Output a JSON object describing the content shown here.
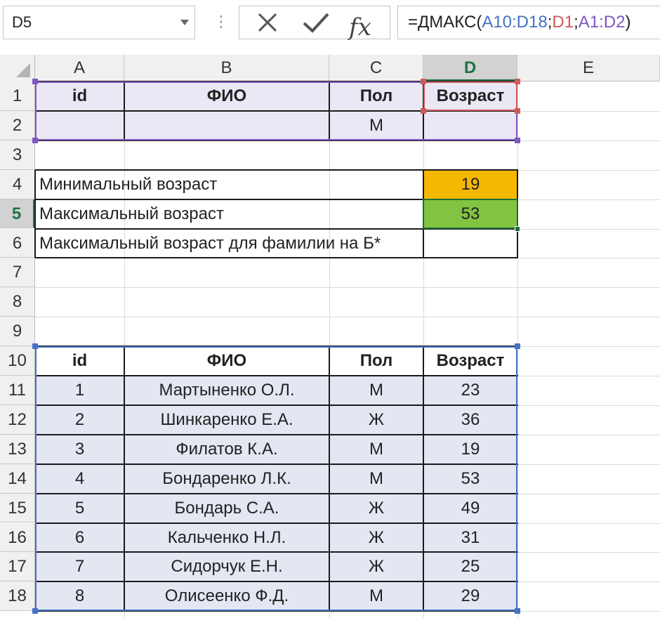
{
  "formula_bar": {
    "name_box": "D5",
    "formula_parts": [
      {
        "text": "=ДМАКС(",
        "ref": ""
      },
      {
        "text": "A10:D18",
        "ref": "a"
      },
      {
        "text": ";",
        "ref": ""
      },
      {
        "text": "D1",
        "ref": "d"
      },
      {
        "text": ";",
        "ref": ""
      },
      {
        "text": "A1:D2",
        "ref": "b"
      },
      {
        "text": ")",
        "ref": ""
      }
    ],
    "fx_label": "fx",
    "dots": "⋮"
  },
  "columns": [
    "A",
    "B",
    "C",
    "D",
    "E"
  ],
  "selected_column": "D",
  "selected_row": "5",
  "rows": [
    "1",
    "2",
    "3",
    "4",
    "5",
    "6",
    "7",
    "8",
    "9",
    "10",
    "11",
    "12",
    "13",
    "14",
    "15",
    "16",
    "17",
    "18"
  ],
  "criteria": {
    "headers": [
      "id",
      "ФИО",
      "Пол",
      "Возраст"
    ],
    "values": [
      "",
      "",
      "М",
      ""
    ]
  },
  "summary": [
    {
      "label": "Минимальный возраст",
      "value": "19"
    },
    {
      "label": "Максимальный возраст",
      "value": "53"
    },
    {
      "label": "Максимальный возраст для фамилии на Б*",
      "value": ""
    }
  ],
  "table": {
    "headers": [
      "id",
      "ФИО",
      "Пол",
      "Возраст"
    ],
    "rows": [
      [
        "1",
        "Мартыненко О.Л.",
        "М",
        "23"
      ],
      [
        "2",
        "Шинкаренко Е.А.",
        "Ж",
        "36"
      ],
      [
        "3",
        "Филатов К.А.",
        "М",
        "19"
      ],
      [
        "4",
        "Бондаренко Л.К.",
        "М",
        "53"
      ],
      [
        "5",
        "Бондарь С.А.",
        "Ж",
        "49"
      ],
      [
        "6",
        "Кальченко Н.Л.",
        "Ж",
        "31"
      ],
      [
        "7",
        "Сидорчук Е.Н.",
        "Ж",
        "25"
      ],
      [
        "8",
        "Олисеенко Ф.Д.",
        "М",
        "29"
      ]
    ]
  },
  "colors": {
    "min_fill": "#f5b800",
    "max_fill": "#82c341",
    "selection": "#1e6b3a",
    "range_database": "#4472c4",
    "range_field": "#d05a5a",
    "range_criteria": "#7e57c2"
  }
}
